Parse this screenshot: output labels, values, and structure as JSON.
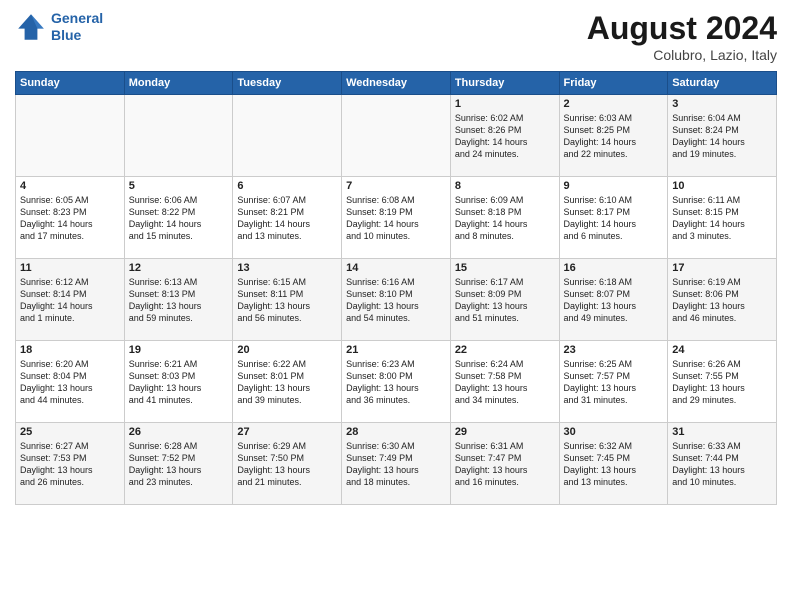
{
  "header": {
    "logo_line1": "General",
    "logo_line2": "Blue",
    "month": "August 2024",
    "location": "Colubro, Lazio, Italy"
  },
  "days_of_week": [
    "Sunday",
    "Monday",
    "Tuesday",
    "Wednesday",
    "Thursday",
    "Friday",
    "Saturday"
  ],
  "weeks": [
    [
      {
        "day": "",
        "content": ""
      },
      {
        "day": "",
        "content": ""
      },
      {
        "day": "",
        "content": ""
      },
      {
        "day": "",
        "content": ""
      },
      {
        "day": "1",
        "content": "Sunrise: 6:02 AM\nSunset: 8:26 PM\nDaylight: 14 hours\nand 24 minutes."
      },
      {
        "day": "2",
        "content": "Sunrise: 6:03 AM\nSunset: 8:25 PM\nDaylight: 14 hours\nand 22 minutes."
      },
      {
        "day": "3",
        "content": "Sunrise: 6:04 AM\nSunset: 8:24 PM\nDaylight: 14 hours\nand 19 minutes."
      }
    ],
    [
      {
        "day": "4",
        "content": "Sunrise: 6:05 AM\nSunset: 8:23 PM\nDaylight: 14 hours\nand 17 minutes."
      },
      {
        "day": "5",
        "content": "Sunrise: 6:06 AM\nSunset: 8:22 PM\nDaylight: 14 hours\nand 15 minutes."
      },
      {
        "day": "6",
        "content": "Sunrise: 6:07 AM\nSunset: 8:21 PM\nDaylight: 14 hours\nand 13 minutes."
      },
      {
        "day": "7",
        "content": "Sunrise: 6:08 AM\nSunset: 8:19 PM\nDaylight: 14 hours\nand 10 minutes."
      },
      {
        "day": "8",
        "content": "Sunrise: 6:09 AM\nSunset: 8:18 PM\nDaylight: 14 hours\nand 8 minutes."
      },
      {
        "day": "9",
        "content": "Sunrise: 6:10 AM\nSunset: 8:17 PM\nDaylight: 14 hours\nand 6 minutes."
      },
      {
        "day": "10",
        "content": "Sunrise: 6:11 AM\nSunset: 8:15 PM\nDaylight: 14 hours\nand 3 minutes."
      }
    ],
    [
      {
        "day": "11",
        "content": "Sunrise: 6:12 AM\nSunset: 8:14 PM\nDaylight: 14 hours\nand 1 minute."
      },
      {
        "day": "12",
        "content": "Sunrise: 6:13 AM\nSunset: 8:13 PM\nDaylight: 13 hours\nand 59 minutes."
      },
      {
        "day": "13",
        "content": "Sunrise: 6:15 AM\nSunset: 8:11 PM\nDaylight: 13 hours\nand 56 minutes."
      },
      {
        "day": "14",
        "content": "Sunrise: 6:16 AM\nSunset: 8:10 PM\nDaylight: 13 hours\nand 54 minutes."
      },
      {
        "day": "15",
        "content": "Sunrise: 6:17 AM\nSunset: 8:09 PM\nDaylight: 13 hours\nand 51 minutes."
      },
      {
        "day": "16",
        "content": "Sunrise: 6:18 AM\nSunset: 8:07 PM\nDaylight: 13 hours\nand 49 minutes."
      },
      {
        "day": "17",
        "content": "Sunrise: 6:19 AM\nSunset: 8:06 PM\nDaylight: 13 hours\nand 46 minutes."
      }
    ],
    [
      {
        "day": "18",
        "content": "Sunrise: 6:20 AM\nSunset: 8:04 PM\nDaylight: 13 hours\nand 44 minutes."
      },
      {
        "day": "19",
        "content": "Sunrise: 6:21 AM\nSunset: 8:03 PM\nDaylight: 13 hours\nand 41 minutes."
      },
      {
        "day": "20",
        "content": "Sunrise: 6:22 AM\nSunset: 8:01 PM\nDaylight: 13 hours\nand 39 minutes."
      },
      {
        "day": "21",
        "content": "Sunrise: 6:23 AM\nSunset: 8:00 PM\nDaylight: 13 hours\nand 36 minutes."
      },
      {
        "day": "22",
        "content": "Sunrise: 6:24 AM\nSunset: 7:58 PM\nDaylight: 13 hours\nand 34 minutes."
      },
      {
        "day": "23",
        "content": "Sunrise: 6:25 AM\nSunset: 7:57 PM\nDaylight: 13 hours\nand 31 minutes."
      },
      {
        "day": "24",
        "content": "Sunrise: 6:26 AM\nSunset: 7:55 PM\nDaylight: 13 hours\nand 29 minutes."
      }
    ],
    [
      {
        "day": "25",
        "content": "Sunrise: 6:27 AM\nSunset: 7:53 PM\nDaylight: 13 hours\nand 26 minutes."
      },
      {
        "day": "26",
        "content": "Sunrise: 6:28 AM\nSunset: 7:52 PM\nDaylight: 13 hours\nand 23 minutes."
      },
      {
        "day": "27",
        "content": "Sunrise: 6:29 AM\nSunset: 7:50 PM\nDaylight: 13 hours\nand 21 minutes."
      },
      {
        "day": "28",
        "content": "Sunrise: 6:30 AM\nSunset: 7:49 PM\nDaylight: 13 hours\nand 18 minutes."
      },
      {
        "day": "29",
        "content": "Sunrise: 6:31 AM\nSunset: 7:47 PM\nDaylight: 13 hours\nand 16 minutes."
      },
      {
        "day": "30",
        "content": "Sunrise: 6:32 AM\nSunset: 7:45 PM\nDaylight: 13 hours\nand 13 minutes."
      },
      {
        "day": "31",
        "content": "Sunrise: 6:33 AM\nSunset: 7:44 PM\nDaylight: 13 hours\nand 10 minutes."
      }
    ]
  ]
}
